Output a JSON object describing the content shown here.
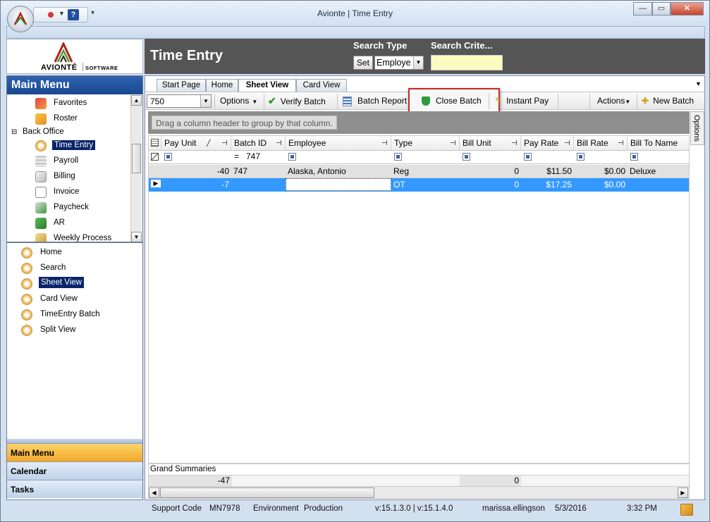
{
  "window": {
    "title": "Avionte | Time Entry"
  },
  "brand": {
    "name": "AVIONTÉ",
    "sub": "SOFTWARE"
  },
  "header": {
    "title": "Time Entry",
    "search_type_label": "Search Type",
    "search_criteria_label": "Search Crite...",
    "set_button": "Set",
    "search_type_value": "Employe"
  },
  "sidebar": {
    "title": "Main Menu",
    "tree": [
      {
        "label": "Favorites"
      },
      {
        "label": "Roster"
      },
      {
        "label": "Back Office",
        "group": true
      },
      {
        "label": "Time Entry",
        "selected": true
      },
      {
        "label": "Payroll"
      },
      {
        "label": "Billing"
      },
      {
        "label": "Invoice"
      },
      {
        "label": "Paycheck"
      },
      {
        "label": "AR"
      },
      {
        "label": "Weekly Process"
      }
    ],
    "views": [
      {
        "label": "Home"
      },
      {
        "label": "Search"
      },
      {
        "label": "Sheet View",
        "selected": true
      },
      {
        "label": "Card View"
      },
      {
        "label": "TimeEntry Batch"
      },
      {
        "label": "Split View"
      }
    ],
    "nav": [
      "Main Menu",
      "Calendar",
      "Tasks"
    ]
  },
  "tabs": [
    {
      "label": "Start Page"
    },
    {
      "label": "Home"
    },
    {
      "label": "Sheet View",
      "active": true
    },
    {
      "label": "Card View"
    }
  ],
  "toolbar": {
    "batch_value": "750",
    "options": "Options",
    "verify_batch": "Verify Batch",
    "batch_report": "Batch Report",
    "close_batch": "Close Batch",
    "instant_pay": "Instant Pay",
    "actions": "Actions",
    "new_batch": "New Batch",
    "options_side": "Options"
  },
  "grid": {
    "group_hint": "Drag a column header to group by that column.",
    "columns": [
      "Pay Unit",
      "Batch ID",
      "Employee",
      "Type",
      "Bill Unit",
      "Pay Rate",
      "Bill Rate",
      "Bill To Name"
    ],
    "filter": {
      "batch_id_op": "=",
      "batch_id_value": "747"
    },
    "rows": [
      {
        "pay_unit": "-40",
        "batch_id": "747",
        "employee": "Alaska, Antonio",
        "type": "Reg",
        "bill_unit": "0",
        "pay_rate": "$11.50",
        "bill_rate": "$0.00",
        "bill_to": "Deluxe"
      },
      {
        "pay_unit": "-7",
        "batch_id": "",
        "employee": "",
        "type": "OT",
        "bill_unit": "0",
        "pay_rate": "$17.25",
        "bill_rate": "$0.00",
        "bill_to": ""
      }
    ],
    "summary_label": "Grand Summaries",
    "summary_pay_unit": "-47",
    "summary_bill_unit": "0"
  },
  "status": {
    "support_code_label": "Support Code",
    "support_code": "MN7978",
    "environment_label": "Environment",
    "environment": "Production",
    "version": "v:15.1.3.0 | v:15.1.4.0",
    "user": "marissa.ellingson",
    "date": "5/3/2016",
    "time": "3:32 PM"
  },
  "colors": {
    "accent": "#3399ff",
    "header": "#555555",
    "nav_active": "#f5b935",
    "menu_header": "#1a4790"
  }
}
